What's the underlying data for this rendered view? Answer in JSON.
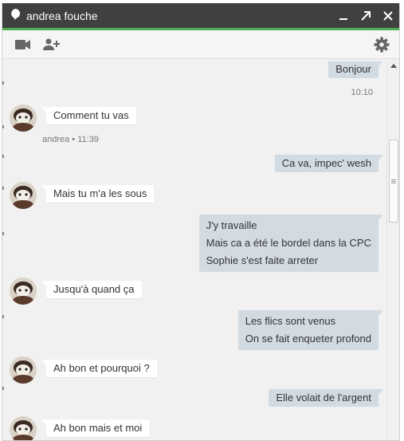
{
  "window": {
    "title": "andrea fouche",
    "accent_color": "#4caf50",
    "titlebar_color": "#404040",
    "controls": [
      "minimize-icon",
      "popout-icon",
      "close-icon"
    ]
  },
  "toolbar": {
    "icons": [
      "video-call-icon",
      "add-person-icon",
      "gear-icon"
    ]
  },
  "messages": [
    {
      "dir": "out",
      "lines": [
        "Bonjour"
      ],
      "meta": "10:10"
    },
    {
      "dir": "in",
      "lines": [
        "Comment tu vas"
      ],
      "meta": "andrea • 11:39"
    },
    {
      "dir": "out",
      "lines": [
        "Ca va, impec' wesh"
      ]
    },
    {
      "dir": "in",
      "lines": [
        "Mais tu m'a les sous"
      ]
    },
    {
      "dir": "out",
      "lines": [
        "J'y travaille",
        "Mais ca a été le bordel dans la CPC",
        "Sophie s'est faite arreter"
      ]
    },
    {
      "dir": "in",
      "lines": [
        "Jusqu'à quand ça"
      ]
    },
    {
      "dir": "out",
      "lines": [
        "Les flics sont venus",
        "On se fait enqueter profond"
      ]
    },
    {
      "dir": "in",
      "lines": [
        "Ah bon et pourquoi ?"
      ]
    },
    {
      "dir": "out",
      "lines": [
        "Elle volait de l'argent"
      ]
    },
    {
      "dir": "in",
      "lines": [
        "Ah bon mais et moi"
      ]
    }
  ]
}
